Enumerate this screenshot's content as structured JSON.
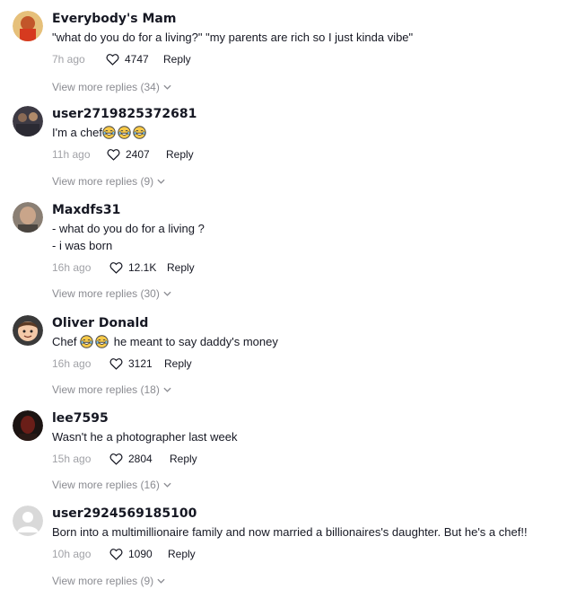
{
  "comments": [
    {
      "username": "Everybody's Mam",
      "lines": [
        "\"what do you do for a living?\" \"my parents are rich so I just kinda vibe\""
      ],
      "time": "7h ago",
      "likes": "4747",
      "reply_label": "Reply",
      "view_more": "View more replies (34)"
    },
    {
      "username": "user2719825372681",
      "lines": [
        "I'm a chef"
      ],
      "emoji_count": 3,
      "emoji_name": "tears-of-joy",
      "time": "11h ago",
      "likes": "2407",
      "reply_label": "Reply",
      "view_more": "View more replies (9)"
    },
    {
      "username": "Maxdfs31",
      "lines": [
        "- what do you do for a living ?",
        "- i was born"
      ],
      "time": "16h ago",
      "likes": "12.1K",
      "reply_label": "Reply",
      "view_more": "View more replies (30)"
    },
    {
      "username": "Oliver Donald",
      "lines": [
        "Chef",
        "he meant to say daddy's money"
      ],
      "emoji_count": 2,
      "emoji_name": "tears-of-joy",
      "time": "16h ago",
      "likes": "3121",
      "reply_label": "Reply",
      "view_more": "View more replies (18)"
    },
    {
      "username": "lee7595",
      "lines": [
        "Wasn't he a photographer last week"
      ],
      "time": "15h ago",
      "likes": "2804",
      "reply_label": "Reply",
      "view_more": "View more replies (16)"
    },
    {
      "username": "user2924569185100",
      "lines": [
        "Born into a multimillionaire family and now married a billionaires's daughter. But he's a chef!!"
      ],
      "time": "10h ago",
      "likes": "1090",
      "reply_label": "Reply",
      "view_more": "View more replies (9)"
    }
  ],
  "colors": {
    "text": "#161823",
    "muted": "#8a8b91",
    "emoji": "#f7c948"
  }
}
